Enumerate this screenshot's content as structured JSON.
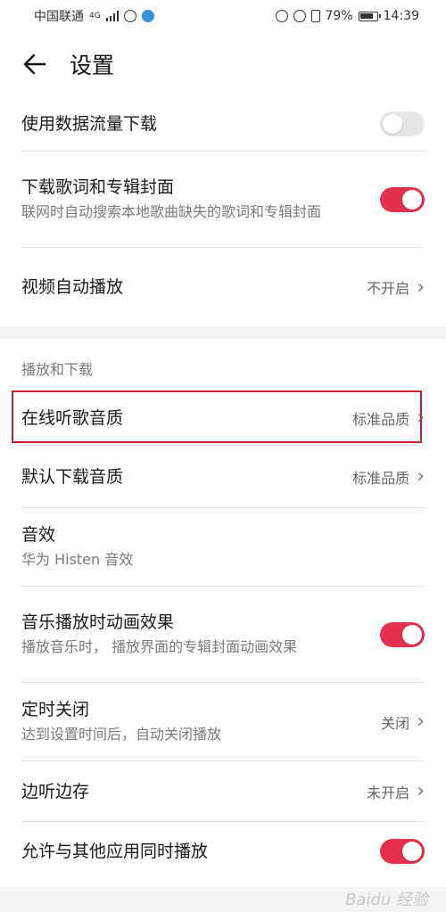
{
  "status_bar": {
    "carrier": "中国联通",
    "network": "4G",
    "battery": "79%",
    "time": "14:39"
  },
  "header": {
    "title": "设置"
  },
  "group1": [
    {
      "title": "使用数据流量下载",
      "toggle": "off"
    },
    {
      "title": "下载歌词和专辑封面",
      "sub": "联网时自动搜索本地歌曲缺失的歌词和专辑封面",
      "toggle": "on"
    },
    {
      "title": "视频自动播放",
      "value": "不开启"
    }
  ],
  "group2": {
    "section_title": "播放和下载",
    "items": [
      {
        "title": "在线听歌音质",
        "value": "标准品质"
      },
      {
        "title": "默认下载音质",
        "value": "标准品质"
      },
      {
        "title": "音效",
        "sub": "华为 Histen 音效"
      },
      {
        "title": "音乐播放时动画效果",
        "sub": "播放音乐时， 播放界面的专辑封面动画效果",
        "toggle": "on"
      },
      {
        "title": "定时关闭",
        "sub": "达到设置时间后，自动关闭播放",
        "value": "关闭"
      },
      {
        "title": "边听边存",
        "value": "未开启"
      },
      {
        "title": "允许与其他应用同时播放",
        "toggle": "on"
      }
    ]
  },
  "colors": {
    "accent": "#e4304d",
    "highlight": "#c3232a"
  },
  "watermark": "Baidu 经验"
}
